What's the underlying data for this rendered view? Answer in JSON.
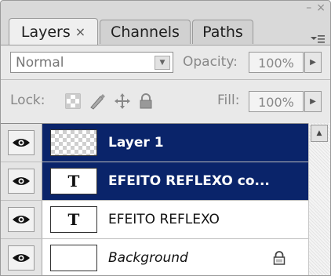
{
  "tabs": [
    {
      "label": "Layers",
      "close": "×",
      "active": true
    },
    {
      "label": "Channels",
      "active": false
    },
    {
      "label": "Paths",
      "active": false
    }
  ],
  "window_controls": {
    "minimize": "–",
    "close": "×"
  },
  "panel_menu_icon": "panel-menu-icon",
  "blend_mode": {
    "value": "Normal"
  },
  "opacity": {
    "label": "Opacity:",
    "value": "100%"
  },
  "lock": {
    "label": "Lock:",
    "icons": [
      "lock-transparent-icon",
      "lock-image-icon",
      "lock-position-icon",
      "lock-all-icon"
    ]
  },
  "fill": {
    "label": "Fill:",
    "value": "100%"
  },
  "layers": [
    {
      "name": "Layer 1",
      "thumb": "transparent",
      "selected": true,
      "visible": true
    },
    {
      "name": "EFEITO REFLEXO co...",
      "thumb": "T",
      "selected": true,
      "visible": true
    },
    {
      "name": "EFEITO REFLEXO",
      "thumb": "T",
      "selected": false,
      "visible": true
    },
    {
      "name": "Background",
      "thumb": "white",
      "selected": false,
      "visible": true,
      "italic": true,
      "locked": true
    }
  ],
  "colors": {
    "selection": "#0a246a",
    "panel": "#d9d9d9"
  }
}
